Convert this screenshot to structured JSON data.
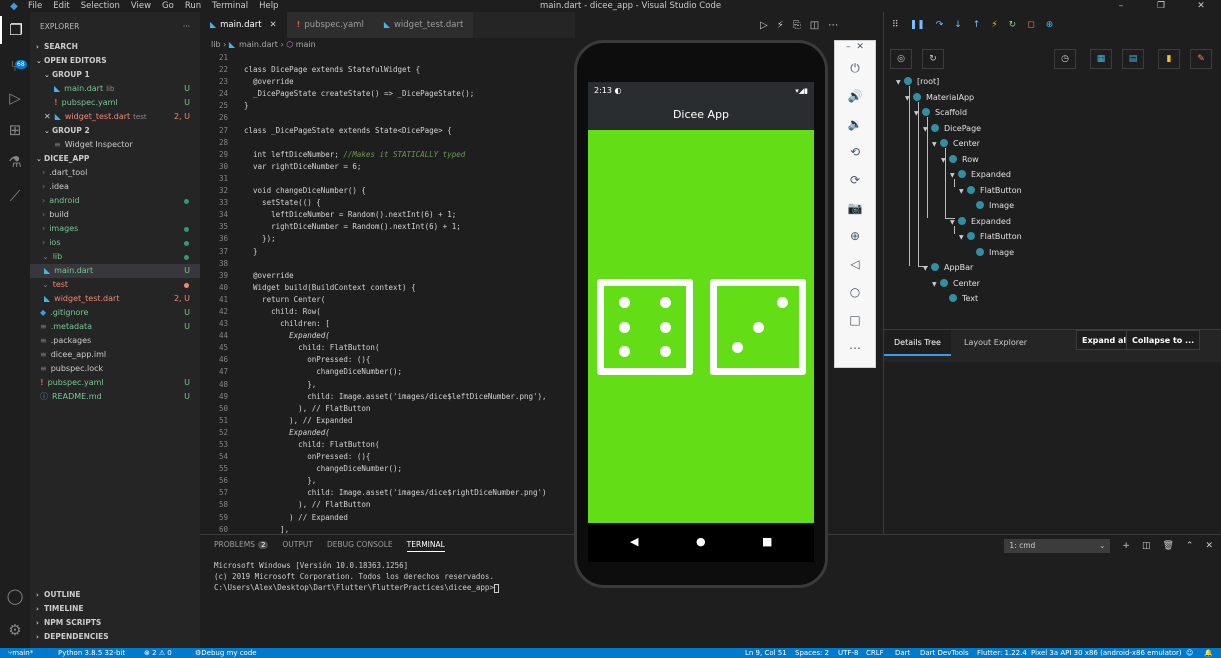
{
  "titlebar": {
    "menu": [
      "File",
      "Edit",
      "Selection",
      "View",
      "Go",
      "Run",
      "Terminal",
      "Help"
    ],
    "window_title": "main.dart - dicee_app - Visual Studio Code",
    "controls": [
      "–",
      "❐",
      "✕"
    ]
  },
  "activity": {
    "badge": "68"
  },
  "sidebar": {
    "title": "EXPLORER",
    "more": "···",
    "search_label": "SEARCH",
    "open_editors_label": "OPEN EDITORS",
    "group1_label": "GROUP 1",
    "group2_label": "GROUP 2",
    "open_editors": [
      {
        "name": "main.dart",
        "sub": "lib",
        "status": "U"
      },
      {
        "name": "pubspec.yaml",
        "sub": "",
        "status": "U"
      },
      {
        "name": "widget_test.dart",
        "sub": "test",
        "status": "2, U"
      }
    ],
    "group2_item": "Widget Inspector",
    "project_label": "DICEE_APP",
    "files": [
      {
        "name": ".dart_tool",
        "status": ""
      },
      {
        "name": ".idea",
        "status": ""
      },
      {
        "name": "android",
        "status": "dot"
      },
      {
        "name": "build",
        "status": ""
      },
      {
        "name": "images",
        "status": "dot"
      },
      {
        "name": "ios",
        "status": "dot"
      },
      {
        "name": "lib",
        "status": "dot"
      },
      {
        "name": "main.dart",
        "status": "U"
      },
      {
        "name": "test",
        "status": "dot"
      },
      {
        "name": "widget_test.dart",
        "status": "2, U"
      },
      {
        "name": ".gitignore",
        "status": "U"
      },
      {
        "name": ".metadata",
        "status": "U"
      },
      {
        "name": ".packages",
        "status": ""
      },
      {
        "name": "dicee_app.iml",
        "status": ""
      },
      {
        "name": "pubspec.lock",
        "status": ""
      },
      {
        "name": "pubspec.yaml",
        "status": "U"
      },
      {
        "name": "README.md",
        "status": "U"
      }
    ],
    "bottom_sections": [
      "OUTLINE",
      "TIMELINE",
      "NPM SCRIPTS",
      "DEPENDENCIES"
    ]
  },
  "editor": {
    "tabs": [
      "main.dart",
      "pubspec.yaml",
      "widget_test.dart"
    ],
    "tab_close": "✕",
    "breadcrumb": [
      "lib",
      "main.dart",
      "main"
    ],
    "line_numbers": [
      "21",
      "22",
      "23",
      "24",
      "25",
      "26",
      "27",
      "28",
      "29",
      "30",
      "31",
      "32",
      "33",
      "34",
      "35",
      "36",
      "37",
      "38",
      "39",
      "40",
      "41",
      "42",
      "43",
      "44",
      "45",
      "46",
      "47",
      "48",
      "49",
      "50",
      "51",
      "52",
      "53",
      "54",
      "55",
      "56",
      "57",
      "58",
      "59",
      "60"
    ],
    "code": {
      "l22": "class DicePage extends StatefulWidget {",
      "l23": "  @override",
      "l24": "  _DicePageState createState() => _DicePageState();",
      "l25": "}",
      "l27": "class _DicePageState extends State<DicePage> {",
      "l29_a": "  int leftDiceNumber; ",
      "l29_b": "//Makes it STATICALLY typed",
      "l30": "  var rightDiceNumber = 6;",
      "l32": "  void changeDiceNumber() {",
      "l33": "    setState(() {",
      "l34": "      leftDiceNumber = Random().nextInt(6) + 1;",
      "l35": "      rightDiceNumber = Random().nextInt(6) + 1;",
      "l36": "    });",
      "l37": "  }",
      "l39": "  @override",
      "l40": "  Widget build(BuildContext context) {",
      "l41": "    return Center(",
      "l42": "      child: Row(",
      "l43": "        children: [",
      "l44": "          Expanded(",
      "l45": "            child: FlatButton(",
      "l46": "              onPressed: (){",
      "l47": "                changeDiceNumber();",
      "l48": "              },",
      "l49": "              child: Image.asset('images/dice$leftDiceNumber.png'),",
      "l50": "            ), // FlatButton",
      "l51": "          ), // Expanded",
      "l52": "          Expanded(",
      "l53": "            child: FlatButton(",
      "l54": "              onPressed: (){",
      "l55": "                changeDiceNumber();",
      "l56": "              },",
      "l57": "              child: Image.asset('images/dice$rightDiceNumber.png')",
      "l58": "            ), // FlatButton",
      "l59": "          ) // Expanded",
      "l60": "        ],"
    }
  },
  "panel": {
    "tabs": [
      "PROBLEMS",
      "OUTPUT",
      "DEBUG CONSOLE",
      "TERMINAL"
    ],
    "problems_count": "2",
    "terminal_select": "1: cmd",
    "terminal_lines": [
      "Microsoft Windows [Versión 10.0.18363.1256]",
      "(c) 2019 Microsoft Corporation. Todos los derechos reservados.",
      "",
      "C:\\Users\\Alex\\Desktop\\Dart\\Flutter\\FlutterPractices\\dicee_app>"
    ]
  },
  "devtools": {
    "tree": [
      {
        "label": "[root]",
        "depth": 0
      },
      {
        "label": "MaterialApp",
        "depth": 1
      },
      {
        "label": "Scaffold",
        "depth": 2
      },
      {
        "label": "DicePage",
        "depth": 3
      },
      {
        "label": "Center",
        "depth": 4
      },
      {
        "label": "Row",
        "depth": 5
      },
      {
        "label": "Expanded",
        "depth": 6
      },
      {
        "label": "FlatButton",
        "depth": 7
      },
      {
        "label": "Image",
        "depth": 8
      },
      {
        "label": "Expanded",
        "depth": 6
      },
      {
        "label": "FlatButton",
        "depth": 7
      },
      {
        "label": "Image",
        "depth": 8
      },
      {
        "label": "AppBar",
        "depth": 3
      },
      {
        "label": "Center",
        "depth": 4
      },
      {
        "label": "Text",
        "depth": 5
      }
    ],
    "tab_details": "Details Tree",
    "tab_layout": "Layout Explorer",
    "expand_all": "Expand all",
    "collapse": "Collapse to ..."
  },
  "phone": {
    "time": "2:13",
    "status_icons": "▾◢▮",
    "app_title": "Dicee App",
    "left_dice": 6,
    "right_dice": 3,
    "bg_color": "#63dd16"
  },
  "status": {
    "branch": "main*",
    "python": "Python 3.8.5 32-bit",
    "problems": "⊗ 2 ⚠ 0",
    "debug": "Debug my code",
    "position": "Ln 9, Col 51",
    "spaces": "Spaces: 2",
    "encoding": "UTF-8",
    "eol": "CRLF",
    "lang": "Dart",
    "devtools": "Dart DevTools",
    "flutter": "Flutter: 1.22.4",
    "device": "Pixel 3a API 30 x86 (android-x86 emulator)"
  }
}
